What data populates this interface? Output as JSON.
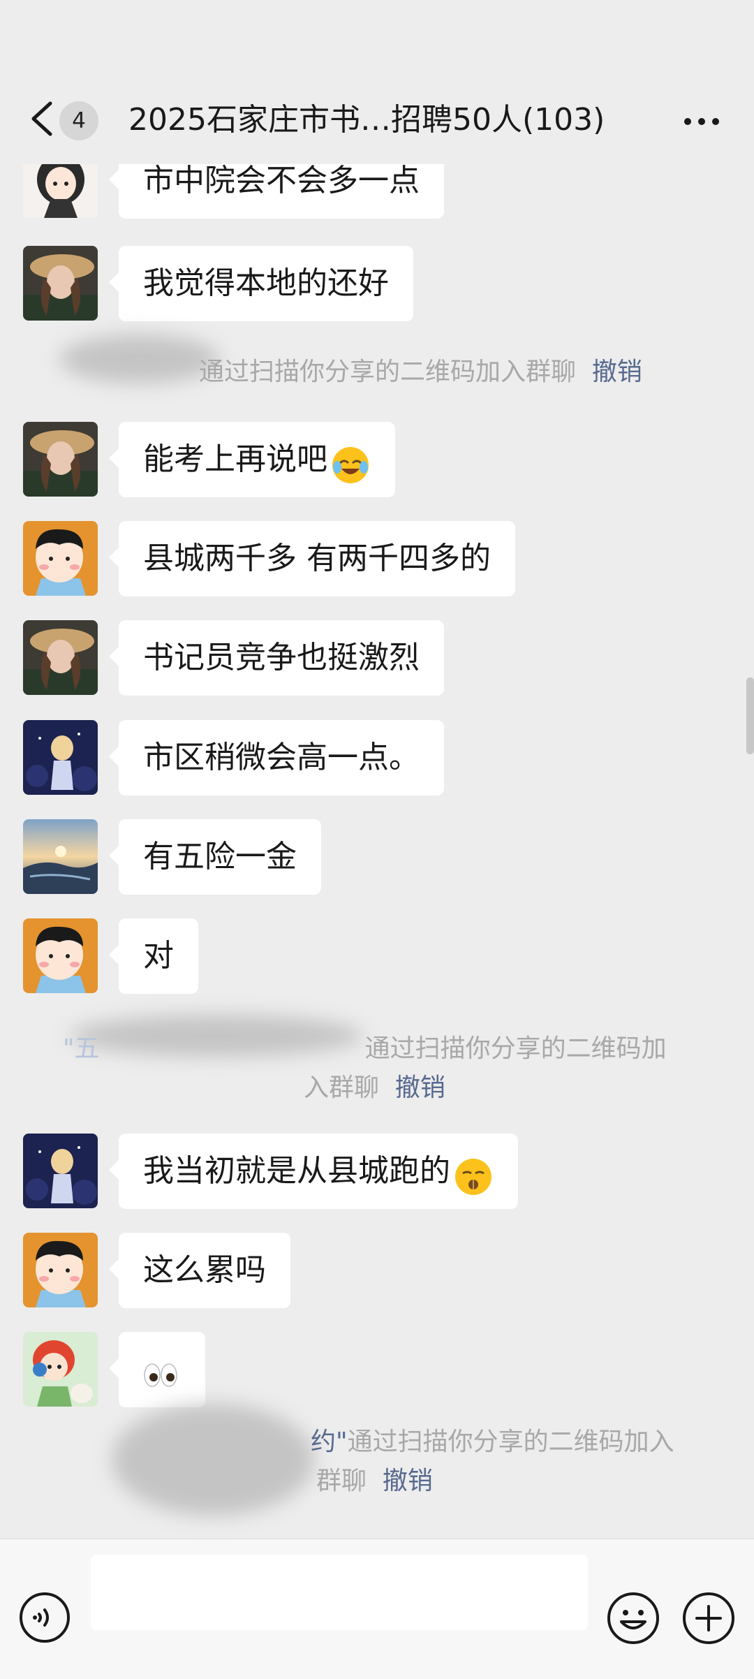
{
  "header": {
    "unread_count": "4",
    "title": "2025石家庄市书…招聘50人(103)"
  },
  "messages": [
    {
      "text": "市中院会不会多一点",
      "emoji": ""
    },
    {
      "text": "我觉得本地的还好",
      "emoji": ""
    },
    {
      "text": "能考上再说吧",
      "emoji": "rolling-laughing-emoji"
    },
    {
      "text": "县城两千多 有两千四多的",
      "emoji": ""
    },
    {
      "text": "书记员竞争也挺激烈",
      "emoji": ""
    },
    {
      "text": "市区稍微会高一点。",
      "emoji": ""
    },
    {
      "text": "有五险一金",
      "emoji": ""
    },
    {
      "text": "对",
      "emoji": ""
    },
    {
      "text": "我当初就是从县城跑的",
      "emoji": "zipper-mouth-emoji"
    },
    {
      "text": "这么累吗",
      "emoji": ""
    },
    {
      "text": "",
      "emoji": "eyes-emoji"
    }
  ],
  "system_notices": [
    {
      "text": "通过扫描你分享的二维码加入群聊",
      "link": "撤销"
    },
    {
      "prefix": "\"五",
      "line1": "通过扫描你分享的二维码加",
      "line2": "入群聊",
      "link": "撤销"
    },
    {
      "prefix": "约\"",
      "line1": "通过扫描你分享的二维码加入",
      "line2": "群聊",
      "link": "撤销"
    }
  ],
  "colors": {
    "background": "#ededed",
    "bubble": "#ffffff",
    "link": "#57698e",
    "system_text": "#a8a8a8"
  }
}
